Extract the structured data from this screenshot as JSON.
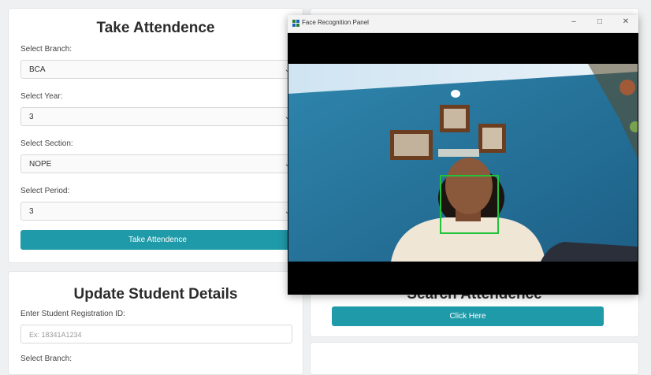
{
  "attendance": {
    "title": "Take Attendence",
    "branch_label": "Select Branch:",
    "branch_value": "BCA",
    "year_label": "Select Year:",
    "year_value": "3",
    "section_label": "Select Section:",
    "section_value": "NOPE",
    "period_label": "Select Period:",
    "period_value": "3",
    "button_label": "Take Attendence"
  },
  "update": {
    "title": "Update Student Details",
    "reg_label": "Enter Student Registration ID:",
    "reg_placeholder": "Ex: 18341A1234",
    "branch_label": "Select Branch:"
  },
  "search": {
    "title": "Search Attendence",
    "button_label": "Click Here"
  },
  "face_window": {
    "title": "Face Recognition Panel",
    "minimize_icon": "minimize-icon",
    "maximize_icon": "maximize-icon",
    "close_icon": "close-icon"
  },
  "colors": {
    "accent": "#1f9aa8",
    "detection_box": "#22c33a"
  }
}
